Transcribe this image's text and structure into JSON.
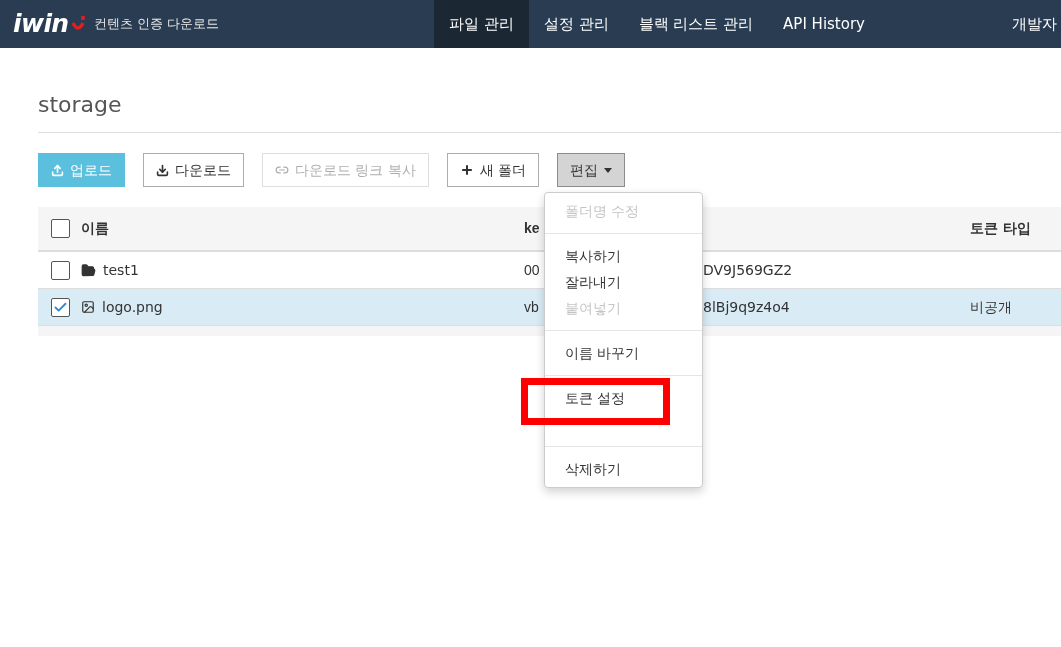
{
  "navbar": {
    "logo": "iwin",
    "subtitle": "컨텐츠 인증 다운로드",
    "menu": [
      {
        "label": "파일 관리",
        "selected": true
      },
      {
        "label": "설정 관리",
        "selected": false
      },
      {
        "label": "블랙 리스트 관리",
        "selected": false
      },
      {
        "label": "API History",
        "selected": false
      }
    ],
    "user": "개발자"
  },
  "page_title": "storage",
  "toolbar": [
    {
      "label": "업로드",
      "kind": "upload",
      "disabled": false
    },
    {
      "label": "다운로드",
      "kind": "download",
      "disabled": false
    },
    {
      "label": "다운로드 링크 복사",
      "kind": "link",
      "disabled": true
    },
    {
      "label": "새 폴더",
      "kind": "plus",
      "disabled": false
    },
    {
      "label": "편집",
      "kind": "dropdown",
      "disabled": false
    }
  ],
  "table": {
    "header": {
      "checked": false,
      "name": "이름",
      "key_start": "ke",
      "token_type": "토큰 타입"
    },
    "rows": [
      {
        "checked": false,
        "kind": "folder",
        "name": "test1",
        "key_start": "00",
        "key_end": "DV9J569GZ2"
      },
      {
        "checked": true,
        "kind": "image",
        "name": "logo.png",
        "key_start": "vb",
        "key_end": "8lBj9q9z4o4",
        "token_type": "비공개"
      }
    ]
  },
  "edit_menu": {
    "items": [
      {
        "label": "폴더명 수정",
        "disabled": true,
        "divider_before": false
      },
      {
        "label": "복사하기",
        "disabled": false,
        "divider_before": true
      },
      {
        "label": "잘라내기",
        "disabled": false,
        "divider_before": false
      },
      {
        "label": "붙여넣기",
        "disabled": true,
        "divider_before": false
      },
      {
        "label": "이름 바꾸기",
        "disabled": false,
        "divider_before": true
      },
      {
        "label": "토큰 설정",
        "disabled": false,
        "divider_before": true,
        "highlighted": true
      },
      {
        "label": "삭제하기",
        "disabled": false,
        "divider_before": true
      }
    ]
  }
}
